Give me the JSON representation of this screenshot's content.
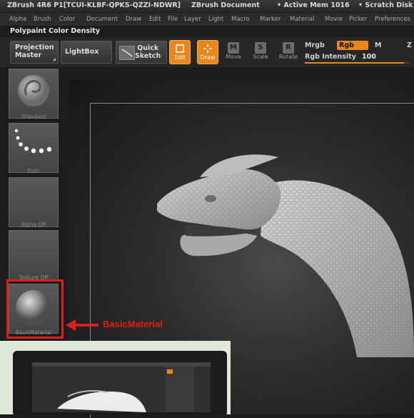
{
  "titlebar": {
    "app": "ZBrush 4R6 P1[TCUI-KLBF-QPKS-QZZI-NDWR]",
    "document": "ZBrush Document",
    "mem": "• Active Mem 1016",
    "scratch": "• Scratch Disk"
  },
  "menu": [
    "Alpha",
    "Brush",
    "Color",
    "Document",
    "Draw",
    "Edit",
    "File",
    "Layer",
    "Light",
    "Macro",
    "Marker",
    "Material",
    "Movie",
    "Picker",
    "Preferences"
  ],
  "palette_title": "Polypaint Color Density",
  "toolbar": {
    "projection_master": [
      "Projection",
      "Master"
    ],
    "lightbox": "LightBox",
    "quick_sketch": [
      "Quick",
      "Sketch"
    ],
    "edit": "Edit",
    "draw": "Draw",
    "move": "Move",
    "scale": "Scale",
    "rotate": "Rotate",
    "move_letter": "M",
    "scale_letter": "S",
    "rotate_letter": "R",
    "mrgb": "Mrgb",
    "rgb": "Rgb",
    "m": "M",
    "rgb_intensity_label": "Rgb  Intensity",
    "rgb_intensity_value": "100",
    "rgb_intensity_level": 0.95
  },
  "sidebar": {
    "standard": "Standard",
    "dots": "Dots",
    "alpha_off": "Alpha  Off",
    "texture_off": "Texture  Off",
    "basic_material": "BasicMaterial"
  },
  "callout": "BasicMaterial",
  "colors": {
    "accent_orange": "#e8871e",
    "callout_red": "#e21b1b"
  }
}
